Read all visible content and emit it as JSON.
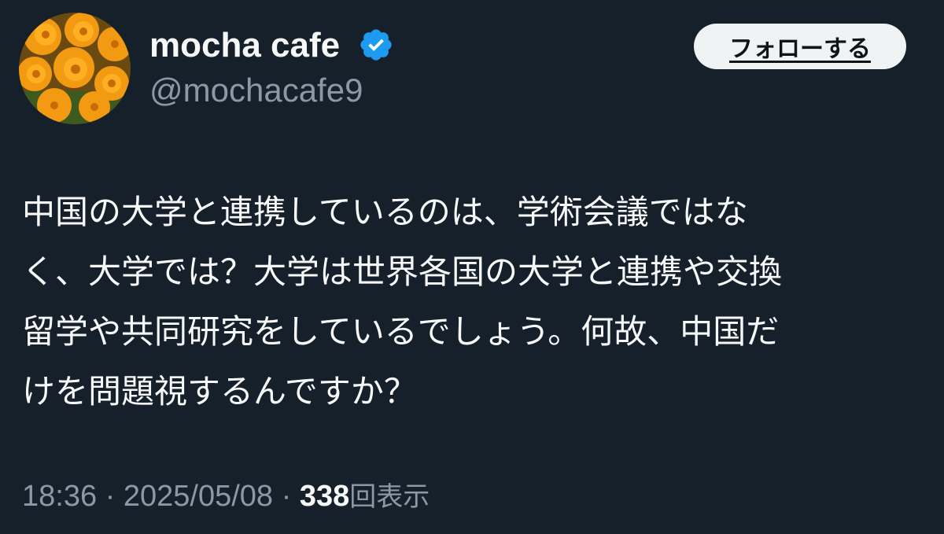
{
  "tweet": {
    "author": {
      "display_name": "mocha cafe",
      "handle": "@mochacafe9",
      "verified": true,
      "avatar": "orange-gazania-flowers"
    },
    "follow_button_label": "フォローする",
    "text_lines": [
      "中国の大学と連携しているのは、学術会議ではな",
      "く、大学では？大学は世界各国の大学と連携や交換",
      "留学や共同研究をしているでしょう。何故、中国だ",
      "けを問題視するんですか？"
    ],
    "time": "18:36",
    "separator": "·",
    "date": "2025/05/08",
    "views_count": "338",
    "views_label": "回表示"
  },
  "colors": {
    "background": "#15202b",
    "primary_text": "#f7f9f9",
    "secondary_text": "#8b98a5",
    "verified_blue": "#1d9bf0",
    "button_bg": "#eff3f4"
  }
}
